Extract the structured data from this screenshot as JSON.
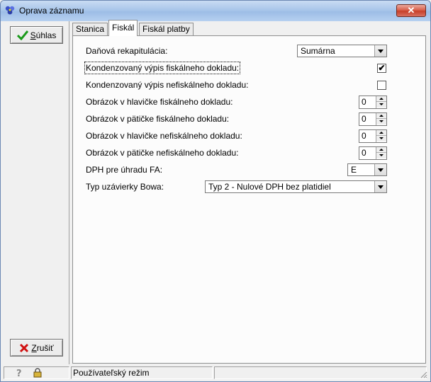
{
  "window": {
    "title": "Oprava záznamu",
    "close_symbol": "✕"
  },
  "buttons": {
    "ok": {
      "accel": "S",
      "rest": "úhlas",
      "icon": "checkmark-icon"
    },
    "cancel": {
      "accel": "Z",
      "rest": "rušiť",
      "icon": "red-x-icon"
    }
  },
  "tabs": [
    {
      "label": "Stanica",
      "active": false
    },
    {
      "label": "Fiskál",
      "active": true
    },
    {
      "label": "Fiskál platby",
      "active": false
    }
  ],
  "form": {
    "danova_rekapitulacia": {
      "label": "Daňová rekapitulácia:",
      "value": "Sumárna"
    },
    "kondenzovany_fiskalny": {
      "label": "Kondenzovaný výpis fiskálneho dokladu:",
      "checked": true,
      "mark": "✔"
    },
    "kondenzovany_nefiskalny": {
      "label": "Kondenzovaný výpis nefiskálneho dokladu:",
      "checked": false,
      "mark": ""
    },
    "obrazok_hlavicka_fiskalny": {
      "label": "Obrázok v hlavičke fiskálneho dokladu:",
      "value": "0"
    },
    "obrazok_paticka_fiskalny": {
      "label": "Obrázok v pätičke fiskálneho dokladu:",
      "value": "0"
    },
    "obrazok_hlavicka_nefiskalny": {
      "label": "Obrázok v hlavičke nefiskálneho dokladu:",
      "value": "0"
    },
    "obrazok_paticka_nefiskalny": {
      "label": "Obrázok v pätičke nefiskálneho dokladu:",
      "value": "0"
    },
    "dph_uhrada": {
      "label": "DPH pre úhradu FA:",
      "value": "E"
    },
    "typ_uzavierky": {
      "label": "Typ uzávierky Bowa:",
      "value": "Typ 2 - Nulové DPH bez platidiel"
    }
  },
  "statusbar": {
    "mode": "Používateľský režim",
    "icons": [
      "help-icon",
      "lock-icon"
    ]
  }
}
